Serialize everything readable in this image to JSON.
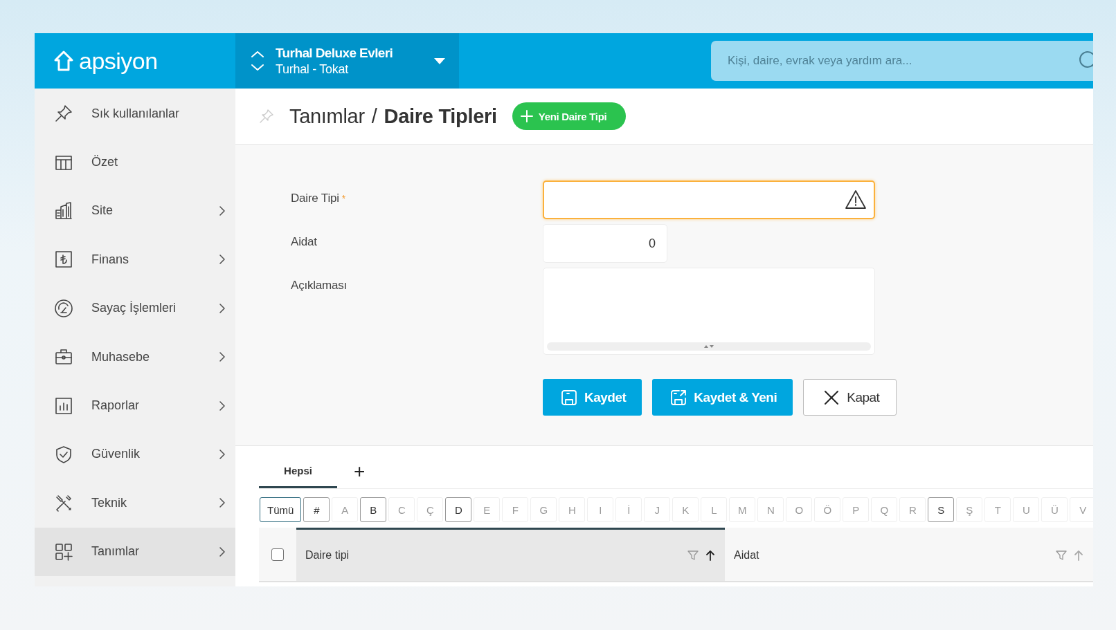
{
  "app": {
    "logo": "apsiyon"
  },
  "project": {
    "name": "Turhal Deluxe Evleri",
    "location": "Turhal - Tokat"
  },
  "search": {
    "placeholder": "Kişi, daire, evrak veya yardım ara..."
  },
  "sidebar": {
    "items": [
      {
        "label": "Sık kullanılanlar",
        "has_submenu": false,
        "selected": false
      },
      {
        "label": "Özet",
        "has_submenu": false,
        "selected": false
      },
      {
        "label": "Site",
        "has_submenu": true,
        "selected": false
      },
      {
        "label": "Finans",
        "has_submenu": true,
        "selected": false
      },
      {
        "label": "Sayaç İşlemleri",
        "has_submenu": true,
        "selected": false
      },
      {
        "label": "Muhasebe",
        "has_submenu": true,
        "selected": false
      },
      {
        "label": "Raporlar",
        "has_submenu": true,
        "selected": false
      },
      {
        "label": "Güvenlik",
        "has_submenu": true,
        "selected": false
      },
      {
        "label": "Teknik",
        "has_submenu": true,
        "selected": false
      },
      {
        "label": "Tanımlar",
        "has_submenu": true,
        "selected": true
      }
    ]
  },
  "page": {
    "breadcrumb_parent": "Tanımlar",
    "separator": "/",
    "title": "Daire Tipleri",
    "new_button": "Yeni Daire Tipi"
  },
  "form": {
    "fields": [
      {
        "label": "Daire Tipi",
        "required_mark": "*",
        "kind": "text",
        "invalid": true
      },
      {
        "label": "Aidat",
        "kind": "number",
        "value": "0",
        "invalid": false
      },
      {
        "label": "Açıklaması",
        "kind": "textarea",
        "invalid": false
      }
    ],
    "buttons": [
      {
        "label": "Kaydet",
        "kind": "save"
      },
      {
        "label": "Kaydet & Yeni",
        "kind": "savenew"
      },
      {
        "label": "Kapat",
        "kind": "close"
      }
    ]
  },
  "list": {
    "tabs": [
      {
        "label": "Hepsi",
        "selected": true
      }
    ],
    "add_tab": "+",
    "letters": [
      {
        "label": "Tümü",
        "enabled": true,
        "selected": true
      },
      {
        "label": "#",
        "enabled": true,
        "selected": false
      },
      {
        "label": "A",
        "enabled": false,
        "selected": false
      },
      {
        "label": "B",
        "enabled": true,
        "selected": false
      },
      {
        "label": "C",
        "enabled": false,
        "selected": false
      },
      {
        "label": "Ç",
        "enabled": false,
        "selected": false
      },
      {
        "label": "D",
        "enabled": true,
        "selected": false
      },
      {
        "label": "E",
        "enabled": false,
        "selected": false
      },
      {
        "label": "F",
        "enabled": false,
        "selected": false
      },
      {
        "label": "G",
        "enabled": false,
        "selected": false
      },
      {
        "label": "H",
        "enabled": false,
        "selected": false
      },
      {
        "label": "I",
        "enabled": false,
        "selected": false
      },
      {
        "label": "İ",
        "enabled": false,
        "selected": false
      },
      {
        "label": "J",
        "enabled": false,
        "selected": false
      },
      {
        "label": "K",
        "enabled": false,
        "selected": false
      },
      {
        "label": "L",
        "enabled": false,
        "selected": false
      },
      {
        "label": "M",
        "enabled": false,
        "selected": false
      },
      {
        "label": "N",
        "enabled": false,
        "selected": false
      },
      {
        "label": "O",
        "enabled": false,
        "selected": false
      },
      {
        "label": "Ö",
        "enabled": false,
        "selected": false
      },
      {
        "label": "P",
        "enabled": false,
        "selected": false
      },
      {
        "label": "Q",
        "enabled": false,
        "selected": false
      },
      {
        "label": "R",
        "enabled": false,
        "selected": false
      },
      {
        "label": "S",
        "enabled": true,
        "selected": false
      },
      {
        "label": "Ş",
        "enabled": false,
        "selected": false
      },
      {
        "label": "T",
        "enabled": false,
        "selected": false
      },
      {
        "label": "U",
        "enabled": false,
        "selected": false
      },
      {
        "label": "Ü",
        "enabled": false,
        "selected": false
      },
      {
        "label": "V",
        "enabled": false,
        "selected": false
      }
    ],
    "table": {
      "select_all": {
        "checked": false
      },
      "columns": [
        {
          "label": "Daire tipi",
          "sorted": true
        },
        {
          "label": "Aidat",
          "sorted": false
        }
      ]
    }
  }
}
